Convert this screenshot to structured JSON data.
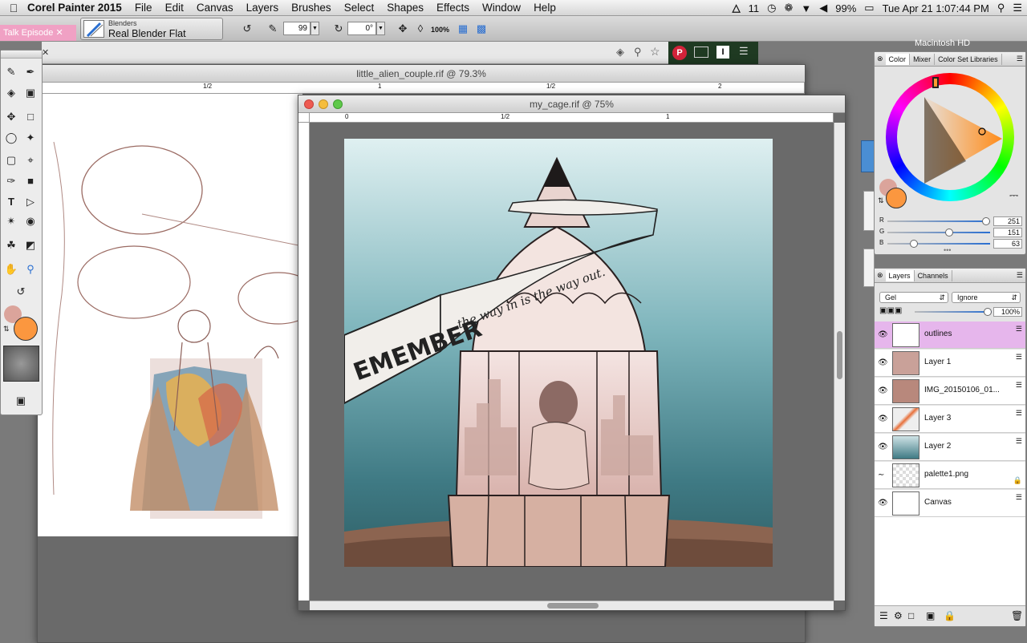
{
  "menubar": {
    "app_name": "Corel Painter 2015",
    "items": [
      "File",
      "Edit",
      "Canvas",
      "Layers",
      "Brushes",
      "Select",
      "Shapes",
      "Effects",
      "Window",
      "Help"
    ],
    "adobe_badge": "11",
    "battery": "99%",
    "clock": "Tue Apr 21  1:07:44 PM"
  },
  "propbar": {
    "talk_episode": "Talk Episode",
    "brush_category": "Blenders",
    "brush_variant": "Real Blender Flat",
    "size_value": "99",
    "angle_value": "0°",
    "zoom_label": "100%"
  },
  "desktop": {
    "drive_label": "Macintosh HD"
  },
  "windows": {
    "back": {
      "title": "little_alien_couple.rif @ 79.3%",
      "ruler_marks": [
        "1/2",
        "1",
        "1/2",
        "2"
      ]
    },
    "front": {
      "title": "my_cage.rif @ 75%",
      "ruler_marks": [
        "0",
        "1/2",
        "1"
      ],
      "banner_left": "EMEMBER",
      "banner_right": "the way in is the way out."
    }
  },
  "color_panel": {
    "tabs": [
      "Color",
      "Mixer",
      "Color Set Libraries"
    ],
    "r": "251",
    "g": "151",
    "b": "63",
    "r_label": "R",
    "g_label": "G",
    "b_label": "B",
    "main_color": "#fb973f"
  },
  "layers_panel": {
    "tabs": [
      "Layers",
      "Channels"
    ],
    "composite_method": "Gel",
    "depth": "Ignore",
    "opacity": "100%",
    "layers": [
      {
        "name": "outlines",
        "selected": true
      },
      {
        "name": "Layer 1",
        "selected": false
      },
      {
        "name": "IMG_20150106_01...",
        "selected": false
      },
      {
        "name": "Layer 3",
        "selected": false
      },
      {
        "name": "Layer 2",
        "selected": false
      },
      {
        "name": "palette1.png",
        "selected": false
      },
      {
        "name": "Canvas",
        "selected": false
      }
    ]
  }
}
